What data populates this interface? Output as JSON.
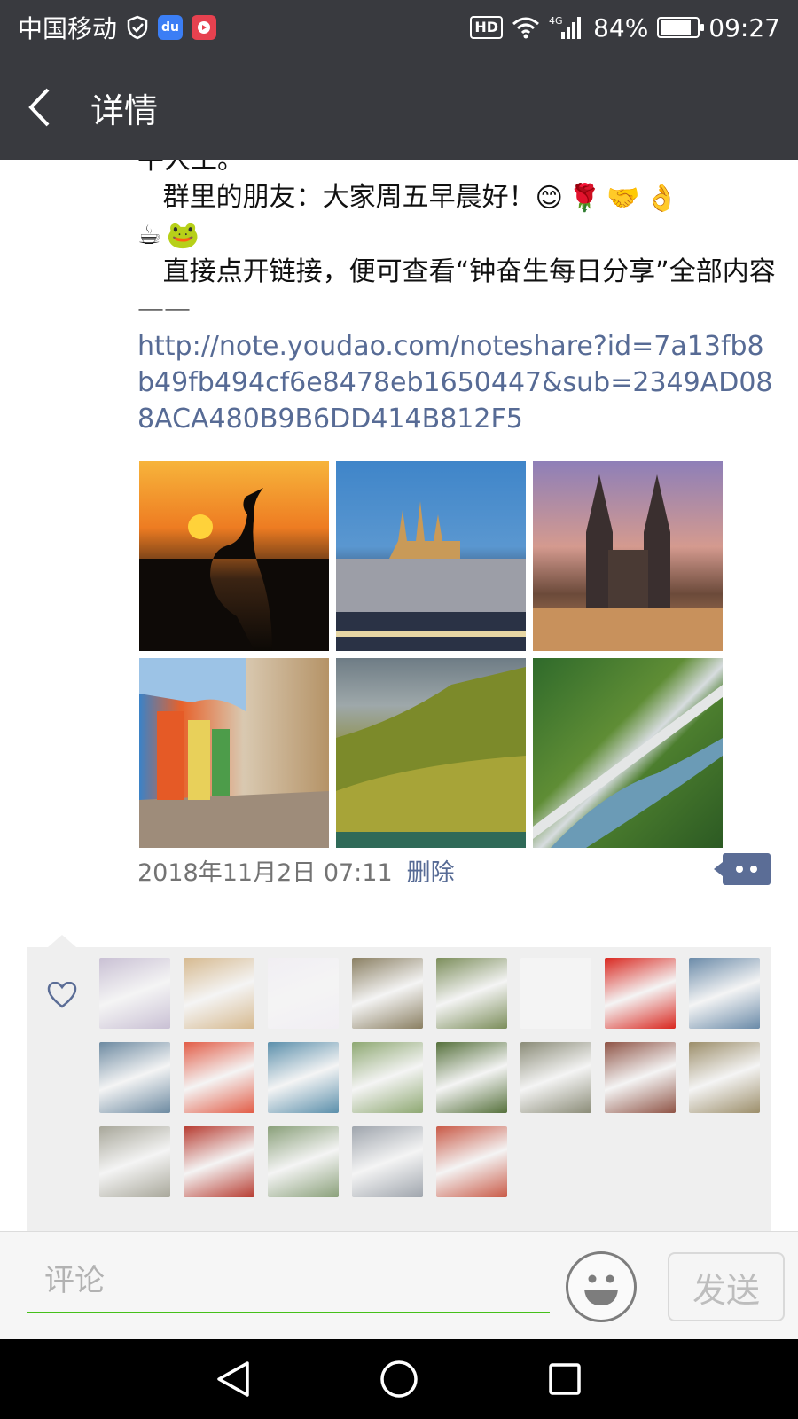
{
  "status_bar": {
    "carrier": "中国移动",
    "hd": "HD",
    "network": "4G",
    "battery_percent": "84%",
    "battery_level": 0.84,
    "time": "09:27"
  },
  "header": {
    "title": "详情"
  },
  "post": {
    "line_top_partial": "平人工。",
    "line_greeting": "   群里的朋友：大家周五早晨好！",
    "line_link_intro": "   直接点开链接，便可查看“钟奋生每日分享”全部内容——",
    "link": "http://note.youdao.com/noteshare?id=7a13fb8b49fb494cf6e8478eb1650447&sub=2349AD088ACA480B9B6DD414B812F5",
    "emojis_row1": [
      "😊",
      "🌹",
      "🤝",
      "👌"
    ],
    "emojis_row2": [
      "☕",
      "🐸"
    ],
    "photos": [
      "sunset-heron-photo",
      "castle-night-photo",
      "cathedral-photo",
      "colorful-street-photo",
      "mountain-valley-photo",
      "aerial-river-photo"
    ],
    "time": "2018年11月2日 07:11",
    "delete_label": "删除"
  },
  "likes": {
    "icon": "heart-icon",
    "avatar_colors": [
      "#c9c0d4",
      "#d6b98f",
      "#f1eef3",
      "#8a7f62",
      "#7b8d5a",
      "#f4f4f4",
      "#d9271f",
      "#6a8aa8",
      "#6d8aa1",
      "#e25c46",
      "#5b8fab",
      "#8ea872",
      "#56713c",
      "#8b8c78",
      "#8f5446",
      "#9c8e6a",
      "#a8a79a",
      "#b73c31",
      "#8aa07a",
      "#9fa5ad",
      "#c95a47"
    ]
  },
  "comment_bar": {
    "placeholder": "评论",
    "emoji_icon": "smiley-icon",
    "send_label": "发送"
  },
  "nav": {
    "back": "back-triangle-icon",
    "home": "home-circle-icon",
    "recents": "recents-square-icon"
  }
}
